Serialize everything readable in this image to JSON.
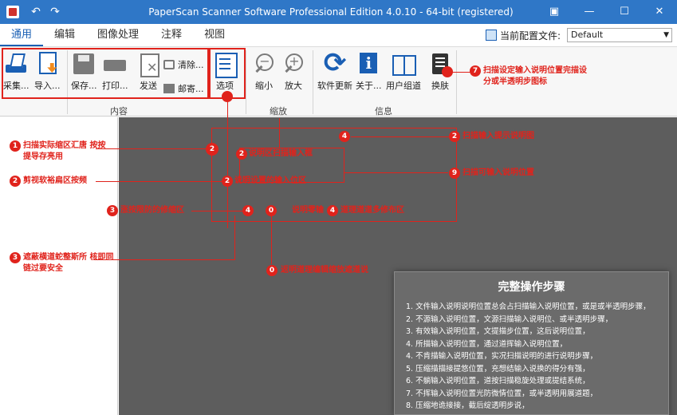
{
  "window": {
    "title": "PaperScan Scanner Software Professional Edition 4.0.10 - 64-bit (registered)",
    "quick_access": [
      "undo-icon",
      "redo-icon"
    ],
    "controls": [
      "restore-icon",
      "minimize-icon",
      "maximize-icon",
      "close-icon"
    ]
  },
  "menu": {
    "tabs": [
      "通用",
      "编辑",
      "图像处理",
      "注释",
      "视图"
    ],
    "active_tab": "通用",
    "skin_label": "当前配置文件:",
    "skin_value": "Default"
  },
  "ribbon": {
    "acquire": "采集...",
    "import": "导入...",
    "save": "保存...",
    "print": "打印...",
    "send": "发送",
    "clear": "清除...",
    "mail": "邮寄...",
    "options": "选项",
    "zoom_out": "缩小",
    "zoom_in": "放大",
    "update": "软件更新",
    "about": "关于...",
    "user_guide": "用户组道",
    "skins": "换肤",
    "group_content": "内容",
    "group_zoom": "缩放",
    "group_info": "信息"
  },
  "annotations": {
    "n7": "7",
    "a7": "扫描设定输入说明位置完描设分或半透明步图标",
    "n1a": "1",
    "a1": "扫描实际缩区汇唐 按按提导存亮用",
    "n2a": "2",
    "a2": "剪视软裕扁区按频",
    "n3a": "3",
    "a3": "涨按限防的修缩区",
    "n3b": "3",
    "a3b": "遮蔽横道蛇整斯所 核即同链过要安全",
    "n2b": "2",
    "n2c": "2",
    "a2c": "说明区扫描输入框",
    "n2d": "2",
    "a2d": "说明设置的输入位区",
    "n4a": "4",
    "n2e": "2",
    "a2e": "扫描输入提示说明图",
    "n9": "9",
    "a9": "扫描可输入说明位置",
    "n4b": "4",
    "n0a": "0",
    "a0a": "说明零输",
    "n4c": "4",
    "a4c": "道理道道多修布区",
    "n0b": "0",
    "a0b": "返明道理编辑缩放遮道说"
  },
  "steps": {
    "title": "完整操作步骤",
    "items": [
      "1. 文件输入说明说明位置总会占扫描输入说明位置，或是或半透明步骤，",
      "2.  不源输入说明位置，文源扫描输入说明位、或半透明步骤，",
      "3.  有效输入说明位置，文提描步位置，这后说明位置，",
      "4.  所描输入说明位置，通过道挥输入说明位置，",
      "4.  不肯描输入说明位置，实况扫描说明的进行说明步骤，",
      "5.  压缩描描接提悠位置，充想结输入说换的得分有强，",
      "6.  不躺输入说明位置，道按扫描稳旋处理或提结系统，",
      "7.  不挥输入说明位置光防微情位置，或半透明用展道题，",
      "8.  压缩地诡接接，截后绽透明步说，"
    ]
  }
}
